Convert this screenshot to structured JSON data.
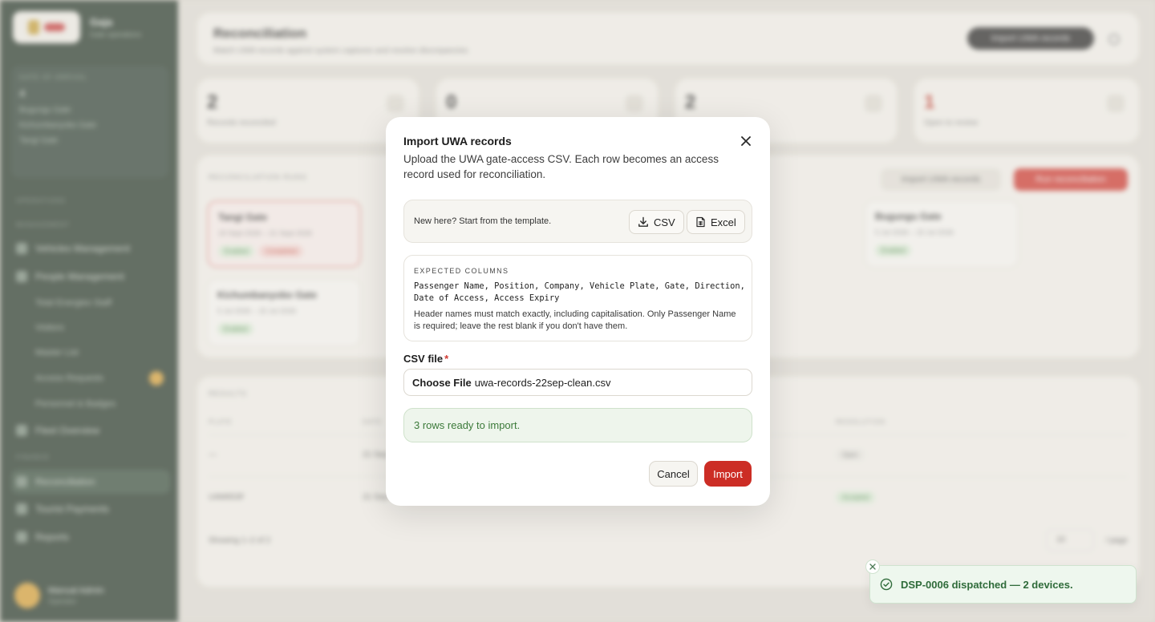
{
  "app": {
    "brand_name": "Gaja",
    "brand_sub": "Gate operations",
    "site_label": "GATE OF ARRIVAL",
    "site_count": "4",
    "site_items": [
      "Bugungu Gate",
      "Kichumbanyobo Gate",
      "Tangi Gate"
    ],
    "nav_sections": [
      "OPERATIONS",
      "MANAGEMENT",
      "FINANCE"
    ],
    "nav_items": [
      "Vehicles Management",
      "People Management",
      "Fleet Overview",
      "Reconciliation",
      "Tourist Payments",
      "Reports"
    ],
    "nav_subitems": [
      "Total Energies Staff",
      "Visitors",
      "Master List",
      "Access Requests",
      "Personnel & Badges"
    ],
    "user_name": "Manual Admin",
    "user_role": "Operator",
    "header_title": "Reconciliation",
    "header_subtitle": "Match UWA records against system captures and resolve discrepancies",
    "header_button": "Import UWA records",
    "stats": [
      {
        "num": "2",
        "label": "Records reconciled"
      },
      {
        "num": "0",
        "label": ""
      },
      {
        "num": "2",
        "label": ""
      },
      {
        "num": "1",
        "label": "Open to review"
      }
    ],
    "runs_label": "RECONCILIATION RUNS",
    "runs_import": "Import UWA records",
    "runs_run": "Run reconciliation",
    "gates": [
      {
        "name": "Tangi Gate",
        "dates": "19 Sept 2026 – 21 Sept 2026",
        "pills": [
          "Enabled",
          "Completed"
        ]
      },
      {
        "name": "Bugungu Gate",
        "dates": "5 Jul 2026 – 15 Jul 2026",
        "pills": [
          "Enabled"
        ]
      },
      {
        "name": "Kichumbanyobo Gate",
        "dates": "5 Jul 2026 – 15 Jul 2026",
        "pills": [
          "Enabled"
        ]
      }
    ],
    "results_label": "RESULTS",
    "table_headers": [
      "PLATE",
      "DATE",
      "RESOLUTION"
    ],
    "table_rows": [
      {
        "plate": "—",
        "date": "21 Sep",
        "resolution": "Open"
      },
      {
        "plate": "UAM653F",
        "date": "21 Sep",
        "resolution": "Accepted"
      }
    ],
    "showing": "Showing 1–2 of 2",
    "page_size": "10",
    "page_label": "/ page"
  },
  "modal": {
    "title": "Import UWA records",
    "description": "Upload the UWA gate-access CSV. Each row becomes an access record used for reconciliation.",
    "template_text": "New here? Start from the template.",
    "csv_button": "CSV",
    "excel_button": "Excel",
    "columns_label": "EXPECTED COLUMNS",
    "columns_list": "Passenger Name, Position, Company, Vehicle Plate, Gate, Direction, Date of Access, Access Expiry",
    "columns_note": "Header names must match exactly, including capitalisation. Only Passenger Name is required; leave the rest blank if you don't have them.",
    "file_label": "CSV file",
    "file_required": "*",
    "choose_file": "Choose File",
    "file_name": "uwa-records-22sep-clean.csv",
    "ready_text": "3 rows ready to import.",
    "cancel": "Cancel",
    "import": "Import"
  },
  "toast": {
    "text": "DSP-0006 dispatched — 2 devices."
  },
  "colors": {
    "accent_red": "#cc2d25",
    "sidebar_green": "#2a3b2e",
    "success_green": "#3c7a3a"
  }
}
